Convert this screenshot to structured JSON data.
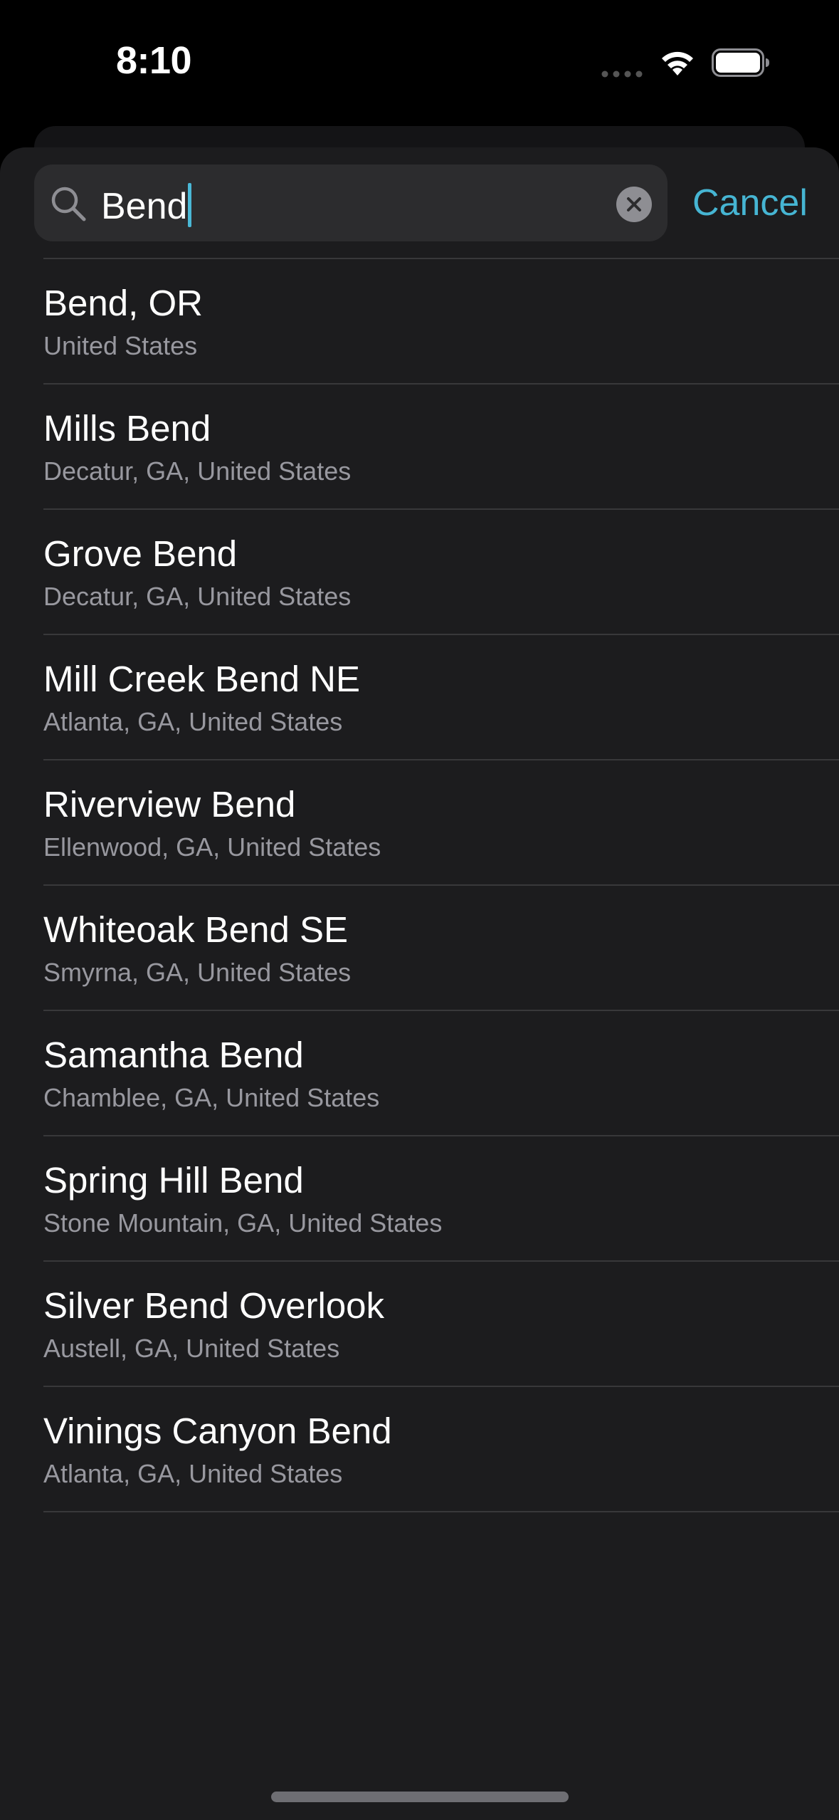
{
  "status_bar": {
    "time": "8:10"
  },
  "search": {
    "value": "Bend",
    "cancel_label": "Cancel"
  },
  "results": [
    {
      "title": "Bend, OR",
      "subtitle": "United States"
    },
    {
      "title": "Mills Bend",
      "subtitle": "Decatur, GA, United States"
    },
    {
      "title": "Grove Bend",
      "subtitle": "Decatur, GA, United States"
    },
    {
      "title": "Mill Creek Bend NE",
      "subtitle": "Atlanta, GA, United States"
    },
    {
      "title": "Riverview Bend",
      "subtitle": "Ellenwood, GA, United States"
    },
    {
      "title": "Whiteoak Bend SE",
      "subtitle": "Smyrna, GA, United States"
    },
    {
      "title": "Samantha Bend",
      "subtitle": "Chamblee, GA, United States"
    },
    {
      "title": "Spring Hill Bend",
      "subtitle": "Stone Mountain, GA, United States"
    },
    {
      "title": "Silver Bend Overlook",
      "subtitle": "Austell, GA, United States"
    },
    {
      "title": "Vinings Canyon Bend",
      "subtitle": "Atlanta, GA, United States"
    }
  ],
  "icons": {
    "search": "search-icon",
    "clear": "clear-icon",
    "wifi": "wifi-icon",
    "battery": "battery-icon",
    "signal": "cellular-signal-icon"
  },
  "colors": {
    "accent": "#46b5d3",
    "sheet_background": "#1c1c1e",
    "field_background": "#2c2c2e",
    "secondary_text": "#98989f"
  }
}
